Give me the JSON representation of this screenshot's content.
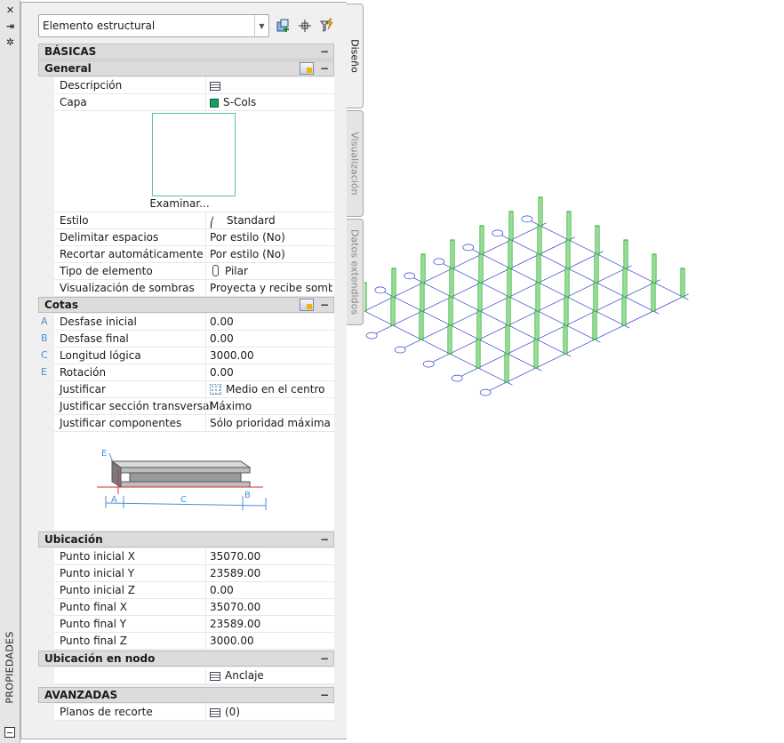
{
  "palette": {
    "title_strip": "#e6e6e6",
    "panel_bg": "#f0f0f0",
    "section_bg": "#dcdcdc",
    "accent_letters": "#4a8fd6",
    "layer_color": "#14a060",
    "model_lines": "#2f3fd0",
    "model_columns": "#22aa22"
  },
  "strip": {
    "close_icon": "✕",
    "autohide_icon": "⇥",
    "settings_icon": "✲",
    "title": "PROPIEDADES"
  },
  "selector": {
    "value": "Elemento estructural"
  },
  "toolbar": {
    "icons": [
      "add-selection-icon",
      "pick-point-icon",
      "quick-select-icon"
    ]
  },
  "tabs": [
    {
      "label": "Diseño",
      "active": true
    },
    {
      "label": "Visualización",
      "active": false
    },
    {
      "label": "Datos extendidos",
      "active": false
    }
  ],
  "sections": {
    "basicas": {
      "title": "BÁSICAS",
      "collapse": "−"
    },
    "general": {
      "title": "General",
      "collapse": "−",
      "descripcion": {
        "label": "Descripción",
        "icon": "table-icon"
      },
      "capa": {
        "label": "Capa",
        "value": "S-Cols"
      },
      "preview_button": "Examinar...",
      "estilo": {
        "label": "Estilo",
        "value": "Standard"
      },
      "delimitar": {
        "label": "Delimitar espacios",
        "value": "Por estilo (No)"
      },
      "recortar": {
        "label": "Recortar automáticamente",
        "value": "Por estilo (No)"
      },
      "tipo": {
        "label": "Tipo de elemento",
        "value": "Pilar"
      },
      "sombras": {
        "label": "Visualización de sombras",
        "value": "Proyecta y recibe sombras"
      }
    },
    "cotas": {
      "title": "Cotas",
      "collapse": "−",
      "rows": [
        {
          "letter": "A",
          "label": "Desfase inicial",
          "value": "0.00"
        },
        {
          "letter": "B",
          "label": "Desfase final",
          "value": "0.00"
        },
        {
          "letter": "C",
          "label": "Longitud lógica",
          "value": "3000.00"
        },
        {
          "letter": "E",
          "label": "Rotación",
          "value": "0.00"
        }
      ],
      "justificar": {
        "label": "Justificar",
        "value": "Medio en el centro"
      },
      "justificar_seccion": {
        "label": "Justificar sección transversal",
        "value": "Máximo"
      },
      "justificar_componentes": {
        "label": "Justificar componentes",
        "value": "Sólo prioridad máxima"
      },
      "diagram_letters": {
        "a": "A",
        "b": "B",
        "c": "C",
        "e": "E"
      }
    },
    "ubicacion": {
      "title": "Ubicación",
      "collapse": "−",
      "rows": [
        {
          "label": "Punto inicial X",
          "value": "35070.00"
        },
        {
          "label": "Punto inicial Y",
          "value": "23589.00"
        },
        {
          "label": "Punto inicial Z",
          "value": "0.00"
        },
        {
          "label": "Punto final X",
          "value": "35070.00"
        },
        {
          "label": "Punto final Y",
          "value": "23589.00"
        },
        {
          "label": "Punto final Z",
          "value": "3000.00"
        }
      ]
    },
    "ubicacion_nodo": {
      "title": "Ubicación en nodo",
      "collapse": "−",
      "anclaje": "Anclaje"
    },
    "avanzadas": {
      "title": "AVANZADAS",
      "collapse": "−",
      "planos": {
        "label": "Planos de recorte",
        "value": "(0)"
      }
    }
  }
}
